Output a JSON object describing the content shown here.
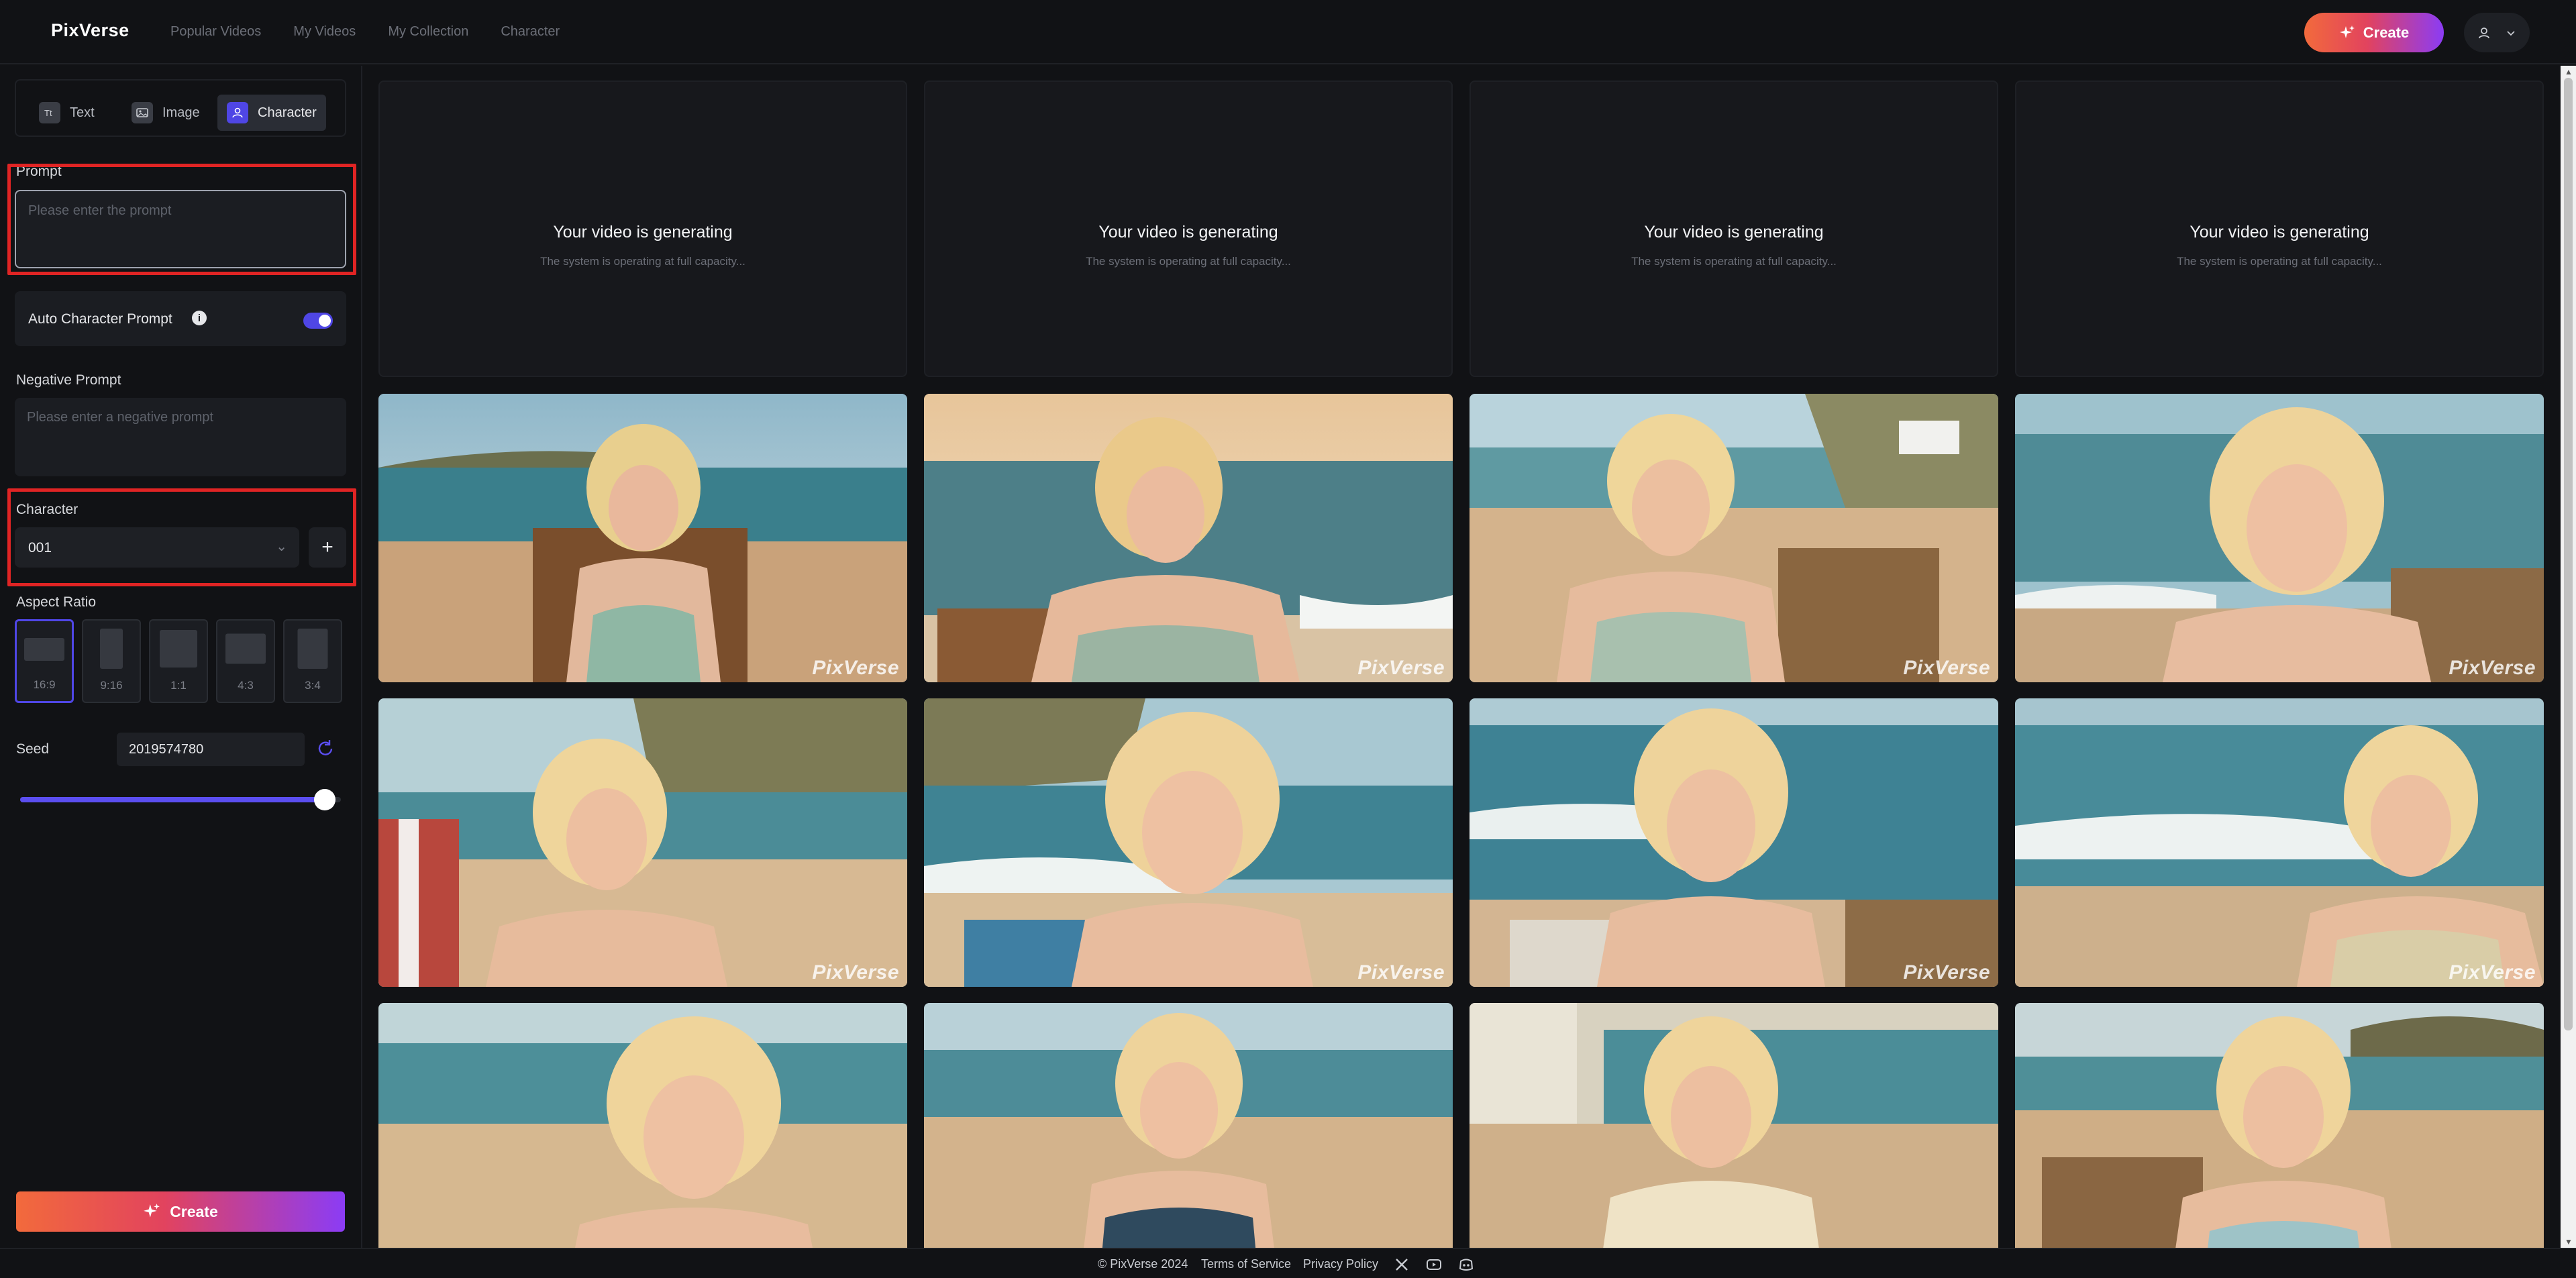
{
  "header": {
    "logo": "PixVerse",
    "nav": [
      "Popular Videos",
      "My Videos",
      "My Collection",
      "Character"
    ],
    "create_label": "Create"
  },
  "sidebar": {
    "tabs": [
      {
        "label": "Text",
        "icon": "text-icon"
      },
      {
        "label": "Image",
        "icon": "image-icon"
      },
      {
        "label": "Character",
        "icon": "character-icon",
        "active": true
      }
    ],
    "prompt": {
      "label": "Prompt",
      "placeholder": "Please enter the prompt",
      "value": ""
    },
    "auto_character": {
      "label": "Auto Character Prompt",
      "enabled": true
    },
    "negative_prompt": {
      "label": "Negative Prompt",
      "placeholder": "Please enter a negative prompt",
      "value": ""
    },
    "character": {
      "label": "Character",
      "selected": "001",
      "add_label": "+"
    },
    "aspect_ratio": {
      "label": "Aspect Ratio",
      "options": [
        "16:9",
        "9:16",
        "1:1",
        "4:3",
        "3:4"
      ],
      "selected": "16:9"
    },
    "seed": {
      "label": "Seed",
      "value": "2019574780",
      "slider_fraction": 0.95
    },
    "create_label": "Create"
  },
  "main": {
    "generating_cards": [
      {
        "title": "Your video is generating",
        "subtitle": "The system is operating at full capacity..."
      },
      {
        "title": "Your video is generating",
        "subtitle": "The system is operating at full capacity..."
      },
      {
        "title": "Your video is generating",
        "subtitle": "The system is operating at full capacity..."
      },
      {
        "title": "Your video is generating",
        "subtitle": "The system is operating at full capacity..."
      }
    ],
    "watermark": "PixVerse",
    "thumbnail_count": 12
  },
  "footer": {
    "copyright": "© PixVerse 2024",
    "terms": "Terms of Service",
    "privacy": "Privacy Policy",
    "social_icons": [
      "x-icon",
      "youtube-icon",
      "discord-icon"
    ]
  },
  "colors": {
    "background": "#111215",
    "panel": "#1b1d22",
    "accent": "#4f46e5",
    "highlight_box": "#e02424",
    "gradient_start": "#f26a3c",
    "gradient_end": "#8b3cf5"
  }
}
